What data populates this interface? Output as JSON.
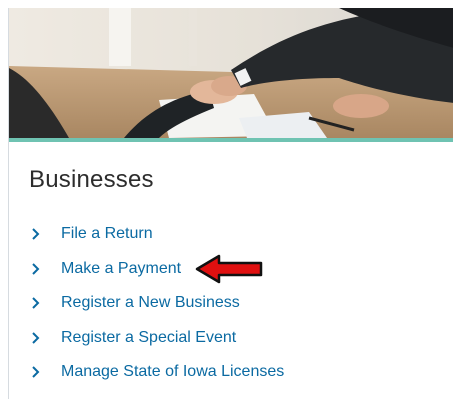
{
  "section": {
    "title": "Businesses"
  },
  "links": [
    {
      "label": "File a Return"
    },
    {
      "label": "Make a Payment"
    },
    {
      "label": "Register a New Business"
    },
    {
      "label": "Register a Special Event"
    },
    {
      "label": "Manage State of Iowa Licenses"
    }
  ],
  "colors": {
    "link": "#0b6aa2",
    "accent_bar": "#6fc3b2",
    "annotation_arrow": "#e01010"
  },
  "icons": {
    "link_marker": "chevron-right-icon",
    "annotation": "left-arrow-icon"
  }
}
